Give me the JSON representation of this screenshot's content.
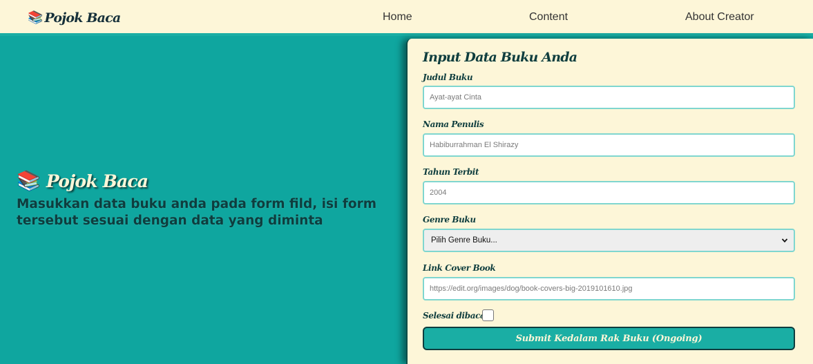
{
  "navbar": {
    "brand_icon": "📚",
    "brand_text": "Pojok Baca",
    "links": [
      "Home",
      "Content",
      "About Creator"
    ]
  },
  "hero": {
    "icon": "📚",
    "title": "Pojok Baca",
    "description": "Masukkan data buku anda pada form fild, isi form tersebut sesuai dengan data yang diminta"
  },
  "form": {
    "title": "Input Data Buku Anda",
    "judul_label": "Judul Buku",
    "judul_placeholder": "Ayat-ayat Cinta",
    "penulis_label": "Nama Penulis",
    "penulis_placeholder": "Habiburrahman El Shirazy",
    "tahun_label": "Tahun Terbit",
    "tahun_placeholder": "2004",
    "genre_label": "Genre Buku",
    "genre_selected": "Pilih Genre Buku...",
    "cover_label": "Link Cover Book",
    "cover_placeholder": "https://edit.org/images/dog/book-covers-big-2019101610.jpg",
    "selesai_label": "Selesai dibaca",
    "selesai_checked": false,
    "submit_label": "Submit Kedalam Rak Buku (Ongoing)"
  },
  "colors": {
    "background": "#0fa69f",
    "cream": "#fdf6d8",
    "dark_teal": "#0e3d3e",
    "accent": "#1aaea4",
    "input_border": "#7fd6cf"
  }
}
